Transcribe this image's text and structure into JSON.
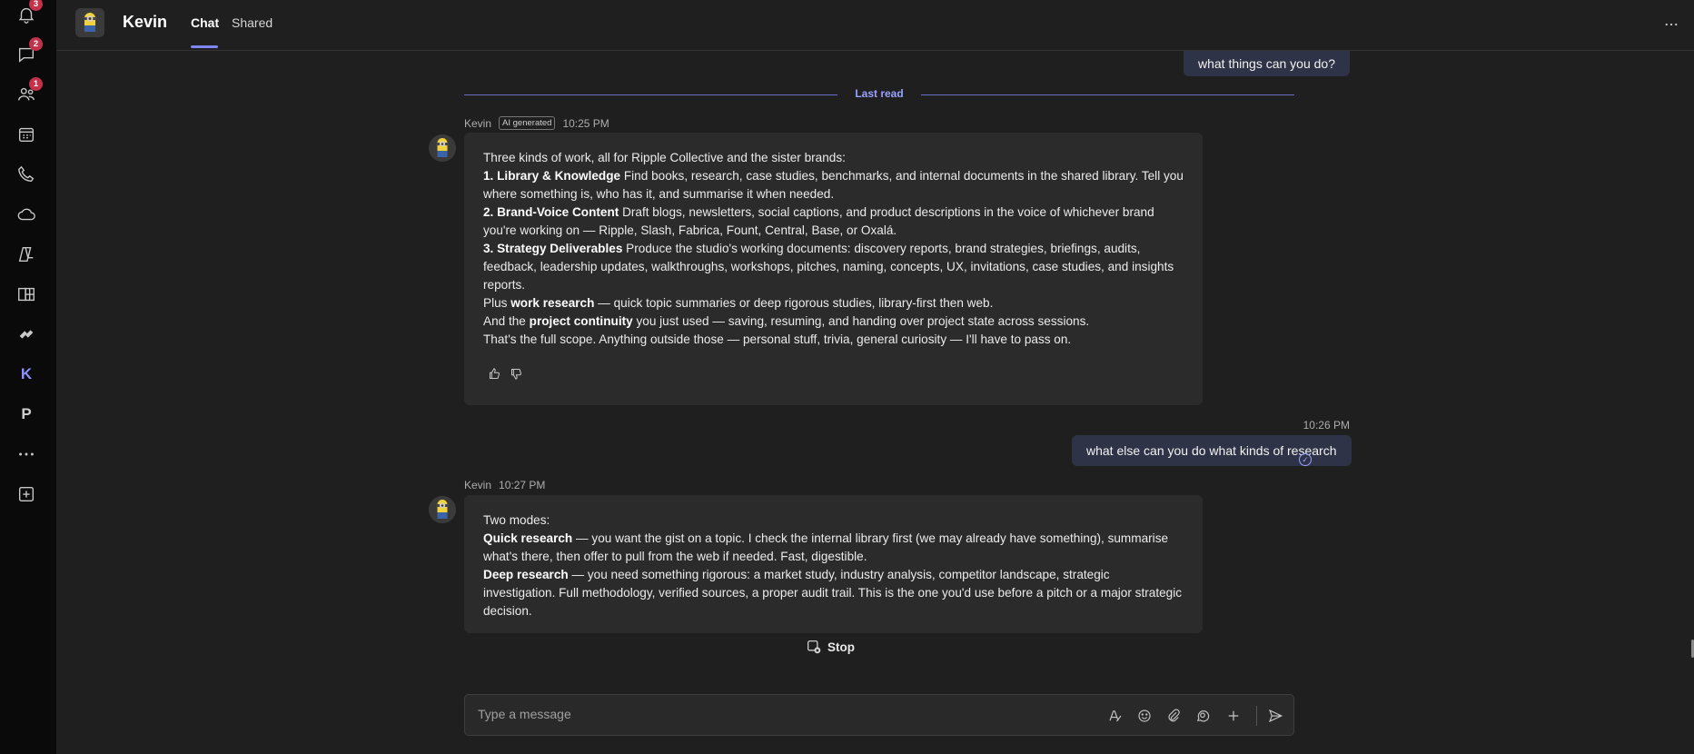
{
  "rail": {
    "items": [
      {
        "name": "activity-icon",
        "badge": "3"
      },
      {
        "name": "chat-icon",
        "badge": "2"
      },
      {
        "name": "teams-icon",
        "badge": "1"
      },
      {
        "name": "calendar-icon",
        "badge": ""
      },
      {
        "name": "calls-icon",
        "badge": ""
      },
      {
        "name": "onedrive-icon",
        "badge": ""
      },
      {
        "name": "copilot-icon",
        "badge": ""
      },
      {
        "name": "planner-icon",
        "badge": ""
      },
      {
        "name": "app-icon",
        "badge": ""
      },
      {
        "name": "kevin-app",
        "letter": "K"
      },
      {
        "name": "p-app",
        "letter": "P"
      },
      {
        "name": "more-apps-icon",
        "badge": ""
      },
      {
        "name": "add-app-icon",
        "badge": ""
      }
    ]
  },
  "header": {
    "title": "Kevin",
    "tabs": [
      "Chat",
      "Shared"
    ],
    "more": "···"
  },
  "conversation": {
    "msg_user_1": "what things can you do?",
    "last_read": "Last read",
    "bot_1": {
      "sender": "Kevin",
      "tag": "AI generated",
      "time": "10:25 PM",
      "intro": "Three kinds of work, all for Ripple Collective and the sister brands:",
      "p1_b": "1. Library & Knowledge",
      "p1": " Find books, research, case studies, benchmarks, and internal documents in the shared library. Tell you where something is, who has it, and summarise it when needed.",
      "p2_b": "2. Brand-Voice Content",
      "p2": " Draft blogs, newsletters, social captions, and product descriptions in the voice of whichever brand you're working on — Ripple, Slash, Fabrica, Fount, Central, Base, or Oxalá.",
      "p3_b": "3. Strategy Deliverables",
      "p3": " Produce the studio's working documents: discovery reports, brand strategies, briefings, audits, feedback, leadership updates, walkthroughs, workshops, pitches, naming, concepts, UX, invitations, case studies, and insights reports.",
      "p4_a": "Plus ",
      "p4_b": "work research",
      "p4_c": " — quick topic summaries or deep rigorous studies, library-first then web.",
      "p5_a": "And the ",
      "p5_b": "project continuity",
      "p5_c": " you just used — saving, resuming, and handing over project state across sessions.",
      "p6": "That's the full scope. Anything outside those — personal stuff, trivia, general curiosity — I'll have to pass on."
    },
    "user_2": {
      "time": "10:26 PM",
      "text": "what else can you do what kinds of research"
    },
    "bot_2": {
      "sender": "Kevin",
      "time": "10:27 PM",
      "intro": "Two modes:",
      "q_b": "Quick research",
      "q": " — you want the gist on a topic. I check the internal library first (we may already have something), summarise what's there, then offer to pull from the web if needed. Fast, digestible.",
      "d_b": "Deep research",
      "d": " — you need something rigorous: a market study, industry analysis, competitor landscape, strategic investigation. Full methodology, verified sources, a proper audit trail. This is the one you'd use before a pitch or a major strategic decision."
    },
    "stop_label": "Stop"
  },
  "composer": {
    "placeholder": "Type a message"
  }
}
